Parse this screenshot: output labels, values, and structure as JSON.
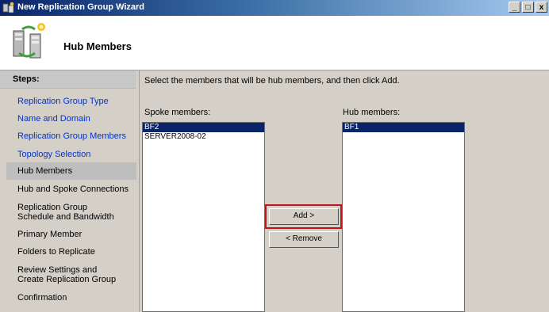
{
  "window": {
    "title": "New Replication Group Wizard",
    "controls": {
      "minimize": "_",
      "maximize": "□",
      "close": "x"
    }
  },
  "header": {
    "title": "Hub Members",
    "icon": "replication-wizard-icon"
  },
  "steps": {
    "heading": "Steps:",
    "items": [
      {
        "label": "Replication Group Type",
        "state": "link"
      },
      {
        "label": "Name and Domain",
        "state": "link"
      },
      {
        "label": "Replication Group Members",
        "state": "link"
      },
      {
        "label": "Topology Selection",
        "state": "link"
      },
      {
        "label": "Hub Members",
        "state": "current"
      },
      {
        "label": "Hub and Spoke Connections",
        "state": "pending"
      },
      {
        "label": "Replication Group Schedule and Bandwidth",
        "state": "pending"
      },
      {
        "label": "Primary Member",
        "state": "pending"
      },
      {
        "label": "Folders to Replicate",
        "state": "pending"
      },
      {
        "label": "Review Settings and Create Replication Group",
        "state": "pending"
      },
      {
        "label": "Confirmation",
        "state": "pending"
      }
    ]
  },
  "main": {
    "instruction": "Select the members that will be hub members, and then click Add.",
    "spoke_label": "Spoke members:",
    "hub_label": "Hub members:",
    "spoke_members": [
      {
        "name": "BF2",
        "selected": true
      },
      {
        "name": "SERVER2008-02",
        "selected": false
      }
    ],
    "hub_members": [
      {
        "name": "BF1",
        "selected": true
      }
    ],
    "add_label": "Add >",
    "remove_label": "< Remove"
  },
  "colors": {
    "selection": "#0a246a",
    "link": "#0033cc",
    "highlight": "#c0141b"
  }
}
